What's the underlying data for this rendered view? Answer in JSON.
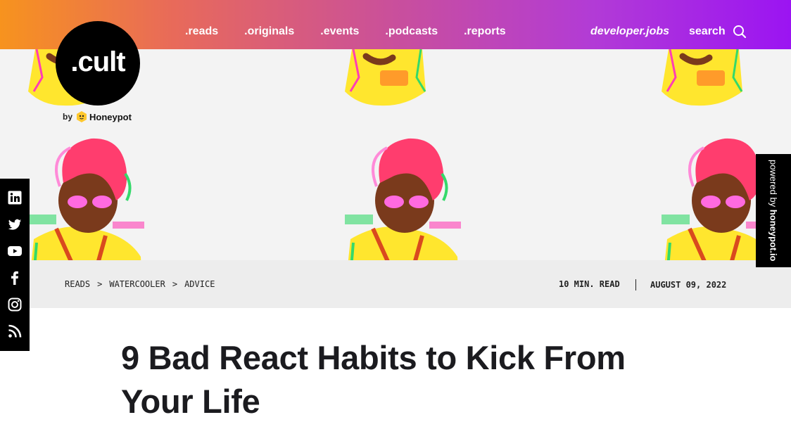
{
  "header": {
    "nav": [
      ".reads",
      ".originals",
      ".events",
      ".podcasts",
      ".reports"
    ],
    "jobs_label": "developer.jobs",
    "search_label": "search"
  },
  "logo": {
    "text": ".cult",
    "byline_by": "by",
    "byline_brand": "Honeypot"
  },
  "breadcrumb": {
    "items": [
      "READS",
      "WATERCOOLER",
      "ADVICE"
    ],
    "separator": ">",
    "read_time": "10 MIN. READ",
    "date": "AUGUST 09, 2022"
  },
  "powered": {
    "prefix": "powered by",
    "brand": "honeypot.io"
  },
  "social": [
    "linkedin-icon",
    "twitter-icon",
    "youtube-icon",
    "facebook-icon",
    "instagram-icon",
    "rss-icon"
  ],
  "article": {
    "title": "9 Bad React Habits to Kick From Your Life"
  },
  "colors": {
    "gradient_start": "#f7931e",
    "gradient_end": "#9b14f2",
    "hero_bg": "#f3f3f3",
    "strip_bg": "#ededed",
    "figure_shirt": "#ffe62e",
    "figure_hair": "#ff3d6e"
  }
}
